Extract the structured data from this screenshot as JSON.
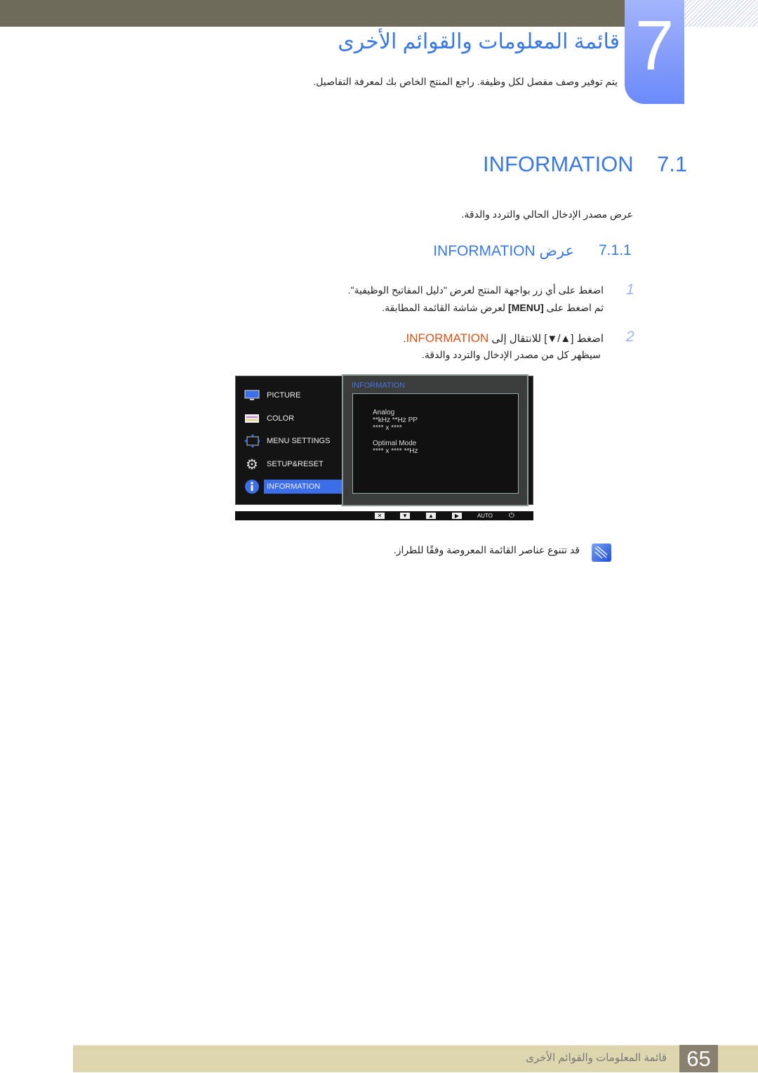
{
  "chapter": {
    "number": "7",
    "title": "قائمة المعلومات والقوائم الأخرى",
    "subtitle": "يتم توفير وصف مفصل لكل وظيفة. راجع المنتج الخاص بك لمعرفة التفاصيل."
  },
  "section": {
    "number": "7.1",
    "title": "INFORMATION",
    "description": "عرض مصدر الإدخال الحالي والتردد والدقة."
  },
  "subsection": {
    "number": "7.1.1",
    "title": "عرض INFORMATION"
  },
  "steps": [
    {
      "number": "1",
      "line1": "اضغط على أي زر بواجهة المنتج لعرض \"دليل المفاتيح الوظيفية\".",
      "line2_pre": "ثم اضغط على ",
      "line2_key": "[MENU]",
      "line2_post": " لعرض شاشة القائمة المطابقة."
    },
    {
      "number": "2",
      "line1_pre": "اضغط [▲/▼] للانتقال إلى ",
      "line1_hl": "INFORMATION",
      "line1_post": ".",
      "line2": "سيظهر كل من مصدر الإدخال والتردد والدقة."
    }
  ],
  "osd": {
    "menu": [
      {
        "label": "PICTURE",
        "icon": "monitor-icon"
      },
      {
        "label": "COLOR",
        "icon": "color-icon"
      },
      {
        "label": "MENU SETTINGS",
        "icon": "menu-settings-icon"
      },
      {
        "label": "SETUP&RESET",
        "icon": "gear-icon"
      },
      {
        "label": "INFORMATION",
        "icon": "info-icon",
        "selected": true
      }
    ],
    "panel_title": "INFORMATION",
    "info": [
      "Analog",
      "**kHz **Hz PP",
      "**** x ****",
      "",
      "Optimal Mode",
      "**** x **** **Hz"
    ],
    "keys": {
      "close": "✕",
      "down": "▼",
      "up": "▲",
      "enter": "▶",
      "auto": "AUTO",
      "power": "⏻"
    }
  },
  "note": {
    "icon": "note-icon",
    "text": "قد تتنوع عناصر القائمة المعروضة وفقًا للطراز."
  },
  "footer": {
    "page": "65",
    "text": "قائمة المعلومات والقوائم الأخرى"
  },
  "colors": {
    "accent": "#3a78e6",
    "highlight": "#d2541b",
    "topbar": "#6e6b5a",
    "footer": "#ded6ae"
  }
}
